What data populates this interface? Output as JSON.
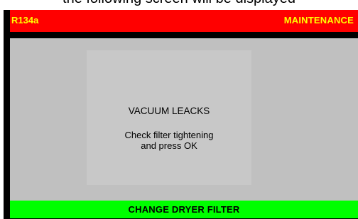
{
  "caption": "the following screen will be displayed",
  "header": {
    "left": "R134a",
    "right": "MAINTENANCE"
  },
  "message": {
    "title": "VACUUM LEACKS",
    "line1": "Check filter tightening",
    "line2": "and press OK"
  },
  "footer": {
    "label": "CHANGE DRYER FILTER"
  },
  "colors": {
    "header_bg": "#ff0000",
    "header_text": "#ffff00",
    "screen_bg": "#c0c0c0",
    "footer_bg": "#00ff00",
    "frame": "#000000"
  }
}
